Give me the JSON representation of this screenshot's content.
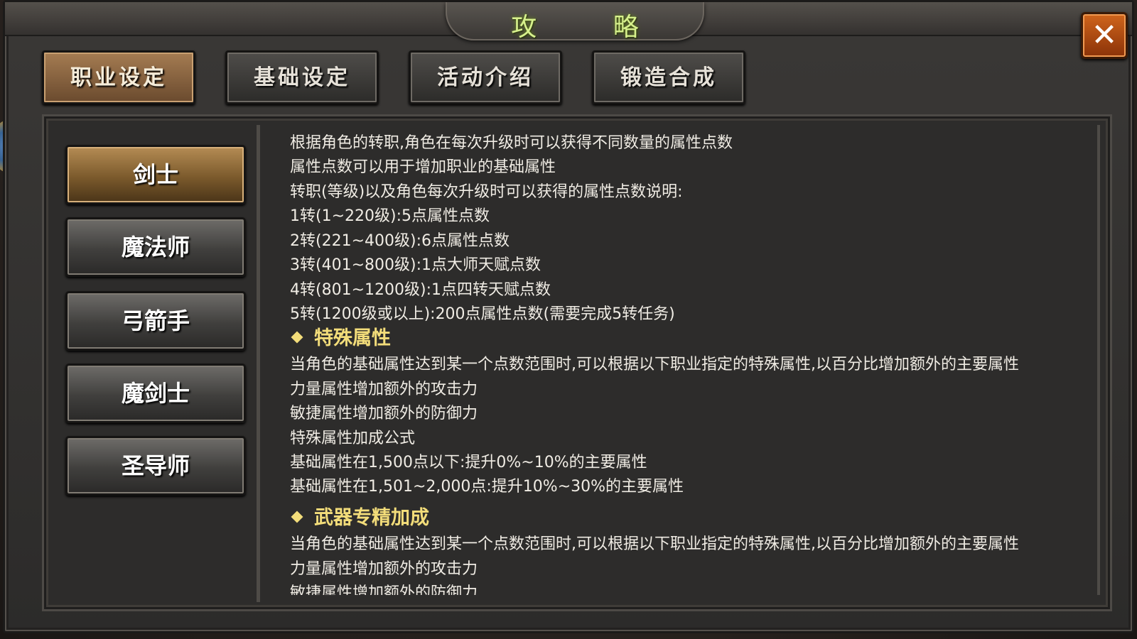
{
  "window": {
    "title": "攻 略",
    "close_symbol": "✕",
    "close_icon": "close-icon"
  },
  "tabs": [
    {
      "label": "职业设定",
      "active": true
    },
    {
      "label": "基础设定",
      "active": false
    },
    {
      "label": "活动介绍",
      "active": false
    },
    {
      "label": "锻造合成",
      "active": false
    }
  ],
  "classes": [
    {
      "label": "剑士",
      "active": true
    },
    {
      "label": "魔法师",
      "active": false
    },
    {
      "label": "弓箭手",
      "active": false
    },
    {
      "label": "魔剑士",
      "active": false
    },
    {
      "label": "圣导师",
      "active": false
    }
  ],
  "content": {
    "intro": [
      "根据角色的转职,角色在每次升级时可以获得不同数量的属性点数",
      "属性点数可以用于增加职业的基础属性",
      "转职(等级)以及角色每次升级时可以获得的属性点数说明:",
      "1转(1~220级):5点属性点数",
      "2转(221~400级):6点属性点数",
      "3转(401~800级):1点大师天赋点数",
      "4转(801~1200级):1点四转天赋点数",
      "5转(1200级或以上):200点属性点数(需要完成5转任务)"
    ],
    "special_heading": "特殊属性",
    "special": [
      "当角色的基础属性达到某一个点数范围时,可以根据以下职业指定的特殊属性,以百分比增加额外的主要属性",
      "力量属性增加额外的攻击力",
      "敏捷属性增加额外的防御力",
      "特殊属性加成公式",
      "基础属性在1,500点以下:提升0%~10%的主要属性",
      "基础属性在1,501~2,000点:提升10%~30%的主要属性"
    ],
    "weapon_heading": "武器专精加成",
    "weapon": [
      "当角色的基础属性达到某一个点数范围时,可以根据以下职业指定的特殊属性,以百分比增加额外的主要属性",
      "力量属性增加额外的攻击力",
      "敏捷属性增加额外的防御力"
    ]
  },
  "colors": {
    "heading": "#f3dd7a",
    "title": "#d6f08c",
    "active_tab": "#a57c52",
    "close": "#d0651c"
  }
}
